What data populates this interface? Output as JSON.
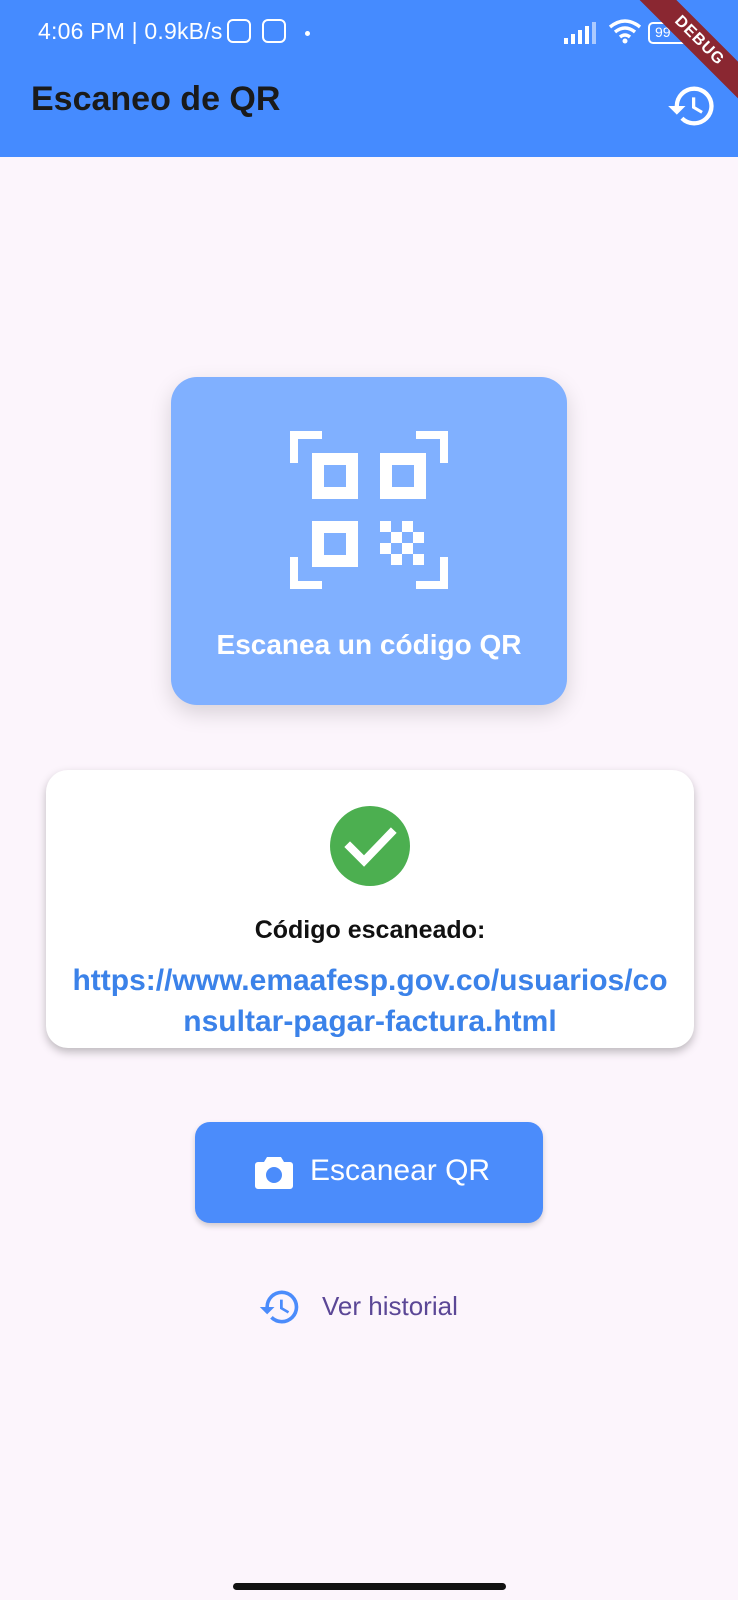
{
  "status_bar": {
    "text": "4:06 PM | 0.9kB/s",
    "battery": "99",
    "icons": [
      "notification-app-icon",
      "notification-app-icon",
      "dot-icon",
      "signal-icon",
      "wifi-icon",
      "battery-icon"
    ]
  },
  "debug_banner": "DEBUG",
  "app_bar": {
    "title": "Escaneo de QR",
    "action_icon": "history-icon"
  },
  "scan_tile": {
    "icon": "qr-code-scanner-icon",
    "label": "Escanea un código QR"
  },
  "result": {
    "icon": "check-circle-icon",
    "label": "Código escaneado:",
    "url": "https://www.emaafesp.gov.co/usuarios/consultar-pagar-factura.html"
  },
  "scan_button": {
    "icon": "camera-icon",
    "label": "Escanear QR"
  },
  "history_link": {
    "icon": "history-icon",
    "label": "Ver historial"
  },
  "colors": {
    "primary": "#458bff",
    "tile": "#80b0ff",
    "success": "#4caf50",
    "link": "#3b82e9",
    "background": "#fcf5fc",
    "history_text": "#5b4796"
  }
}
